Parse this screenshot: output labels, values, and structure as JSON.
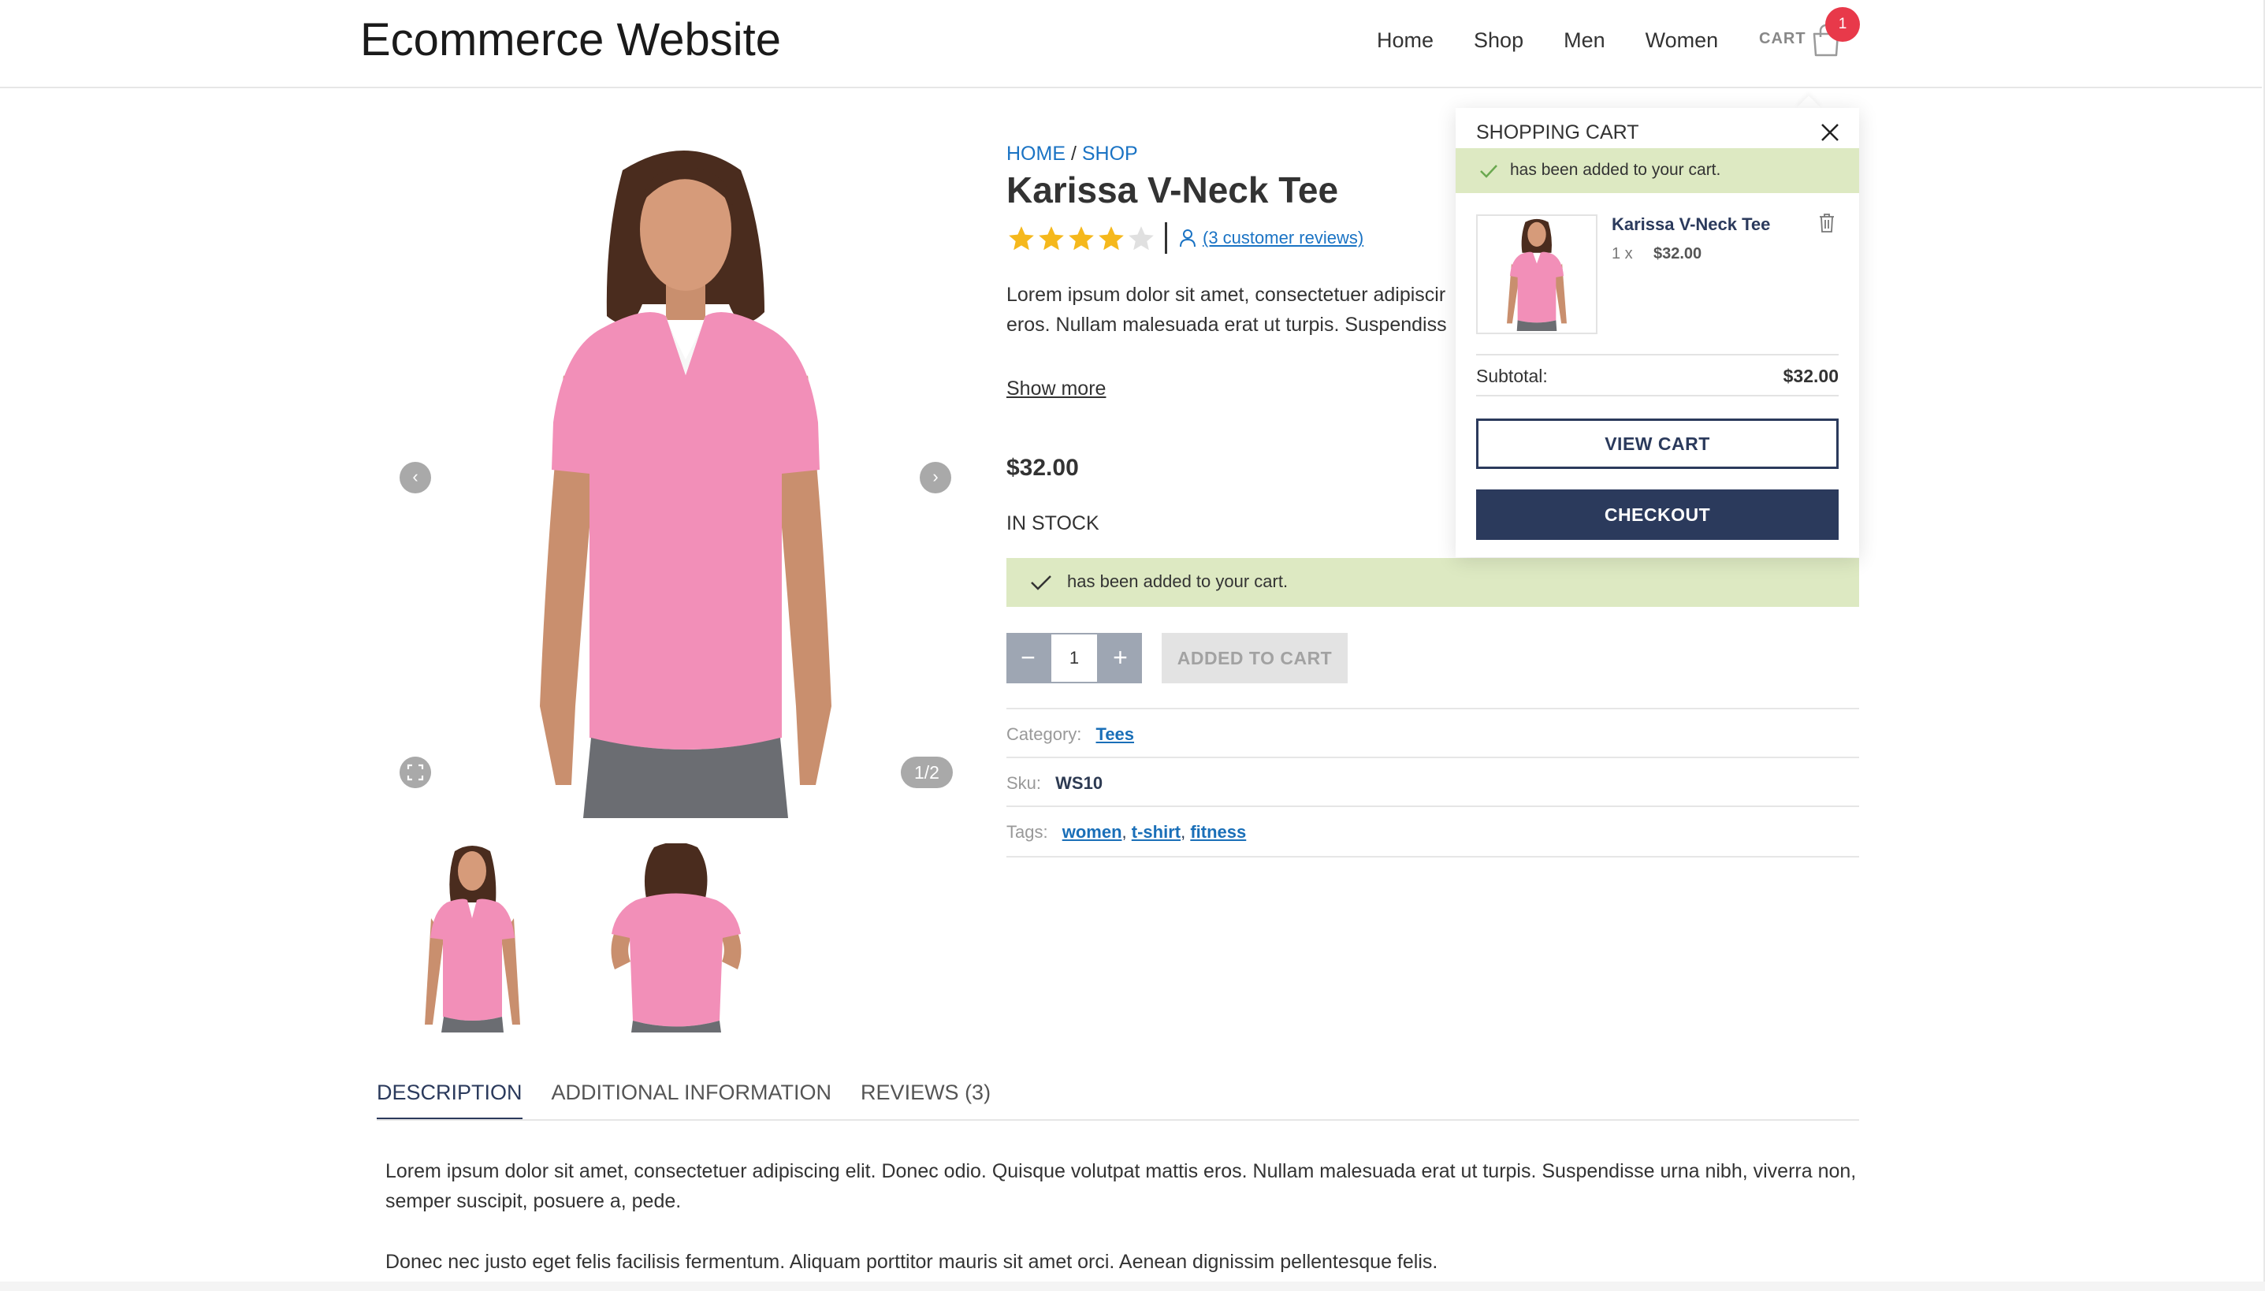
{
  "header": {
    "site_title": "Ecommerce Website",
    "nav": [
      "Home",
      "Shop",
      "Men",
      "Women"
    ],
    "cart_label": "CART",
    "cart_count": "1"
  },
  "gallery": {
    "counter": "1/2",
    "prev_icon": "chevron-left",
    "next_icon": "chevron-right",
    "zoom_icon": "fullscreen"
  },
  "product": {
    "breadcrumb_home": "HOME",
    "breadcrumb_sep": "/",
    "breadcrumb_shop": "SHOP",
    "title": "Karissa V-Neck Tee",
    "rating": 4,
    "rating_max": 5,
    "reviews_link": "(3 customer reviews)",
    "short_desc_line1": "Lorem ipsum dolor sit amet, consectetuer adipiscir",
    "short_desc_line2": "eros. Nullam malesuada erat ut turpis. Suspendiss",
    "show_more": "Show more",
    "price": "$32.00",
    "stock": "IN STOCK",
    "added_notice": "has been added to your cart.",
    "qty_minus": "−",
    "quantity": "1",
    "qty_plus": "+",
    "add_button": "ADDED TO CART",
    "meta": {
      "category_label": "Category:",
      "category_value": "Tees",
      "sku_label": "Sku:",
      "sku_value": "WS10",
      "tags_label": "Tags:",
      "tags": [
        "women",
        "t-shirt",
        "fitness"
      ],
      "tag_sep": ","
    }
  },
  "tabs": {
    "items": [
      "DESCRIPTION",
      "ADDITIONAL INFORMATION",
      "REVIEWS (3)"
    ],
    "active": "DESCRIPTION"
  },
  "description": {
    "p1": "Lorem ipsum dolor sit amet, consectetuer adipiscing elit. Donec odio. Quisque volutpat mattis eros. Nullam malesuada erat ut turpis. Suspendisse urna nibh, viverra non, semper suscipit, posuere a, pede.",
    "p2": "Donec nec justo eget felis facilisis fermentum. Aliquam porttitor mauris sit amet orci. Aenean dignissim pellentesque felis."
  },
  "mini_cart": {
    "title": "SHOPPING CART",
    "notice": "has been added to your cart.",
    "item_name": "Karissa V-Neck Tee",
    "item_qty": "1 x",
    "item_price": "$32.00",
    "subtotal_label": "Subtotal:",
    "subtotal_value": "$32.00",
    "view_cart": "VIEW CART",
    "checkout": "CHECKOUT"
  },
  "colors": {
    "accent_navy": "#2b3a5c",
    "link_blue": "#1a73c4",
    "notice_green": "#dde9c2",
    "badge_red": "#e8394a",
    "star_gold": "#f5b81c",
    "shirt_pink": "#f28fb8"
  }
}
